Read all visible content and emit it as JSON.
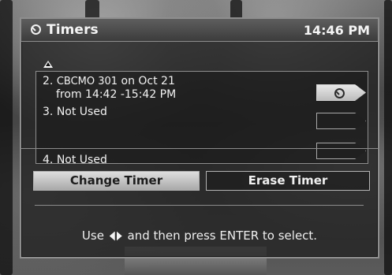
{
  "window": {
    "title": "Timers",
    "time": "14:46 PM"
  },
  "timer_list": {
    "items": [
      {
        "number": "2.",
        "channel": "CBCMO 301",
        "date_text": "on Oct 21",
        "time_text": "from 14:42 -15:42 PM"
      },
      {
        "number": "3.",
        "label": "Not Used"
      },
      {
        "number": "4.",
        "label": "Not Used"
      }
    ]
  },
  "actions": {
    "change_timer": "Change Timer",
    "erase_timer": "Erase Timer"
  },
  "help": {
    "prefix": "Use",
    "suffix": "and then press ENTER to select."
  },
  "icons": {
    "title_icon": "clock-icon",
    "scroll_up_icon": "up-arrow-icon",
    "selected_timer_icon": "clock-icon",
    "navigation_icon": "left-right-arrows-icon"
  },
  "colors": {
    "panel_border": "#8e8e8e",
    "selected_button": "#c8c8c8",
    "text": "#f2f2f2"
  }
}
